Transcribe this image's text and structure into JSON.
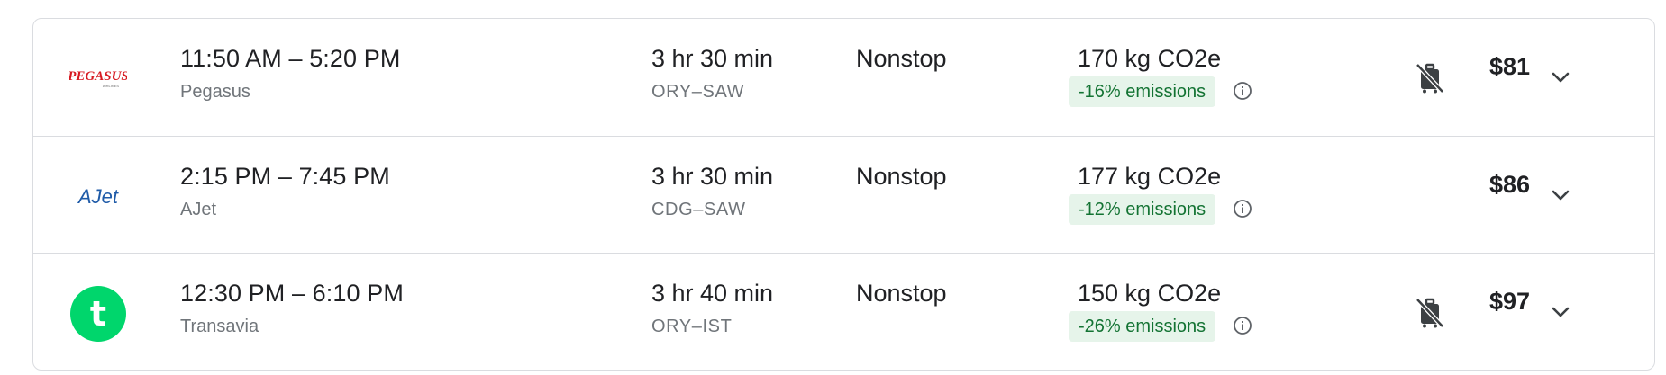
{
  "flights": [
    {
      "airline": "Pegasus",
      "logo_text": "PEGASUS",
      "logo_subtext": "AIRLINES",
      "times": "11:50 AM – 5:20 PM",
      "duration": "3 hr 30 min",
      "route": "ORY–SAW",
      "stops": "Nonstop",
      "emissions": "170 kg CO2e",
      "emissions_badge": "-16% emissions",
      "price": "$81",
      "no_carry_on_icon": true
    },
    {
      "airline": "AJet",
      "logo_text": "AJet",
      "times": "2:15 PM – 7:45 PM",
      "duration": "3 hr 30 min",
      "route": "CDG–SAW",
      "stops": "Nonstop",
      "emissions": "177 kg CO2e",
      "emissions_badge": "-12% emissions",
      "price": "$86",
      "no_carry_on_icon": false
    },
    {
      "airline": "Transavia",
      "logo_text": "t",
      "times": "12:30 PM – 6:10 PM",
      "duration": "3 hr 40 min",
      "route": "ORY–IST",
      "stops": "Nonstop",
      "emissions": "150 kg CO2e",
      "emissions_badge": "-26% emissions",
      "price": "$97",
      "no_carry_on_icon": true
    }
  ],
  "colors": {
    "border": "#dadce0",
    "badge_bg": "#e6f4ea",
    "badge_text": "#137333",
    "secondary_text": "#70757a",
    "pegasus_red": "#d71920",
    "ajet_blue": "#1f5ba8",
    "transavia_green": "#00d66c"
  },
  "icons": [
    "info-icon",
    "no-carry-on-bag-icon",
    "chevron-down-icon"
  ]
}
